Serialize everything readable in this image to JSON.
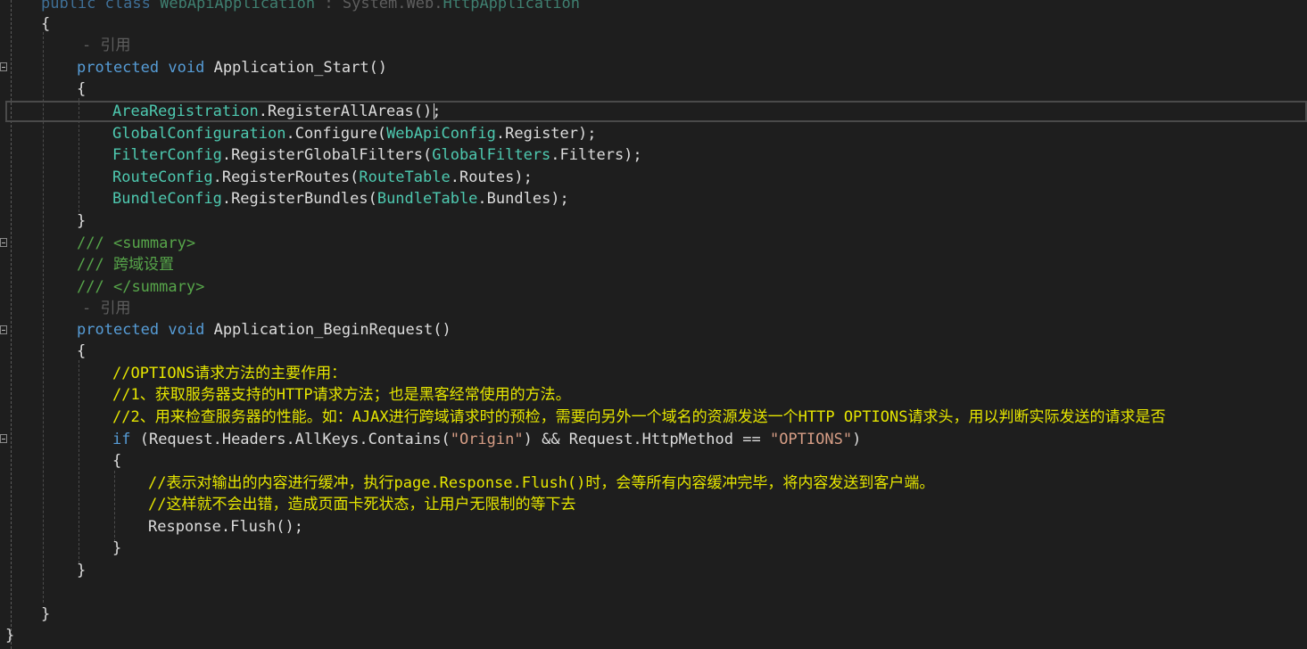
{
  "code": {
    "line_0": {
      "kw1": "public",
      "kw2": "class",
      "type1": "WebApiApplication",
      "sep": ":",
      "ns1": "System",
      "ns2": "Web",
      "type2": "HttpApplication"
    },
    "line_1": {
      "brace": "{"
    },
    "line_2": {
      "ref": "- 引用"
    },
    "line_3": {
      "kw1": "protected",
      "kw2": "void",
      "name": "Application_Start()"
    },
    "line_4": {
      "brace": "{"
    },
    "line_5": {
      "type": "AreaRegistration",
      "call": ".RegisterAllAreas();"
    },
    "line_6": {
      "type": "GlobalConfiguration",
      "call": ".Configure(",
      "arg_type": "WebApiConfig",
      "arg_rest": ".Register);"
    },
    "line_7": {
      "type": "FilterConfig",
      "call": ".RegisterGlobalFilters(",
      "arg_type": "GlobalFilters",
      "arg_rest": ".Filters);"
    },
    "line_8": {
      "type": "RouteConfig",
      "call": ".RegisterRoutes(",
      "arg_type": "RouteTable",
      "arg_rest": ".Routes);"
    },
    "line_9": {
      "type": "BundleConfig",
      "call": ".RegisterBundles(",
      "arg_type": "BundleTable",
      "arg_rest": ".Bundles);"
    },
    "line_10": {
      "brace": "}"
    },
    "line_11": {
      "slashes": "///",
      "tag": "<summary>"
    },
    "line_12": {
      "slashes": "///",
      "text": "跨域设置"
    },
    "line_13": {
      "slashes": "///",
      "tag": "</summary>"
    },
    "line_14": {
      "ref": "- 引用"
    },
    "line_15": {
      "kw1": "protected",
      "kw2": "void",
      "name": "Application_BeginRequest()"
    },
    "line_16": {
      "brace": "{"
    },
    "line_17": {
      "comment": "//OPTIONS请求方法的主要作用："
    },
    "line_18": {
      "comment": "//1、获取服务器支持的HTTP请求方法；也是黑客经常使用的方法。"
    },
    "line_19": {
      "comment": "//2、用来检查服务器的性能。如：AJAX进行跨域请求时的预检，需要向另外一个域名的资源发送一个HTTP OPTIONS请求头，用以判断实际发送的请求是否"
    },
    "line_20": {
      "kw": "if",
      "p1": " (Request.Headers.AllKeys.Contains(",
      "s1": "\"Origin\"",
      "p2": ") && Request.HttpMethod == ",
      "s2": "\"OPTIONS\"",
      "p3": ")"
    },
    "line_21": {
      "brace": "{"
    },
    "line_22": {
      "comment": "//表示对输出的内容进行缓冲，执行page.Response.Flush()时，会等所有内容缓冲完毕，将内容发送到客户端。"
    },
    "line_23": {
      "comment": "//这样就不会出错，造成页面卡死状态，让用户无限制的等下去"
    },
    "line_24": {
      "code": "Response.Flush();"
    },
    "line_25": {
      "brace": "}"
    },
    "line_26": {
      "brace": "}"
    },
    "line_28": {
      "brace": "}"
    },
    "line_29": {
      "brace": "}"
    }
  },
  "colors": {
    "background": "#1e1e1e",
    "keyword": "#569cd6",
    "type": "#4ec9b0",
    "text": "#dcdcdc",
    "comment": "#57a64a",
    "comment_cn": "#e6e600",
    "string": "#d69d85"
  }
}
